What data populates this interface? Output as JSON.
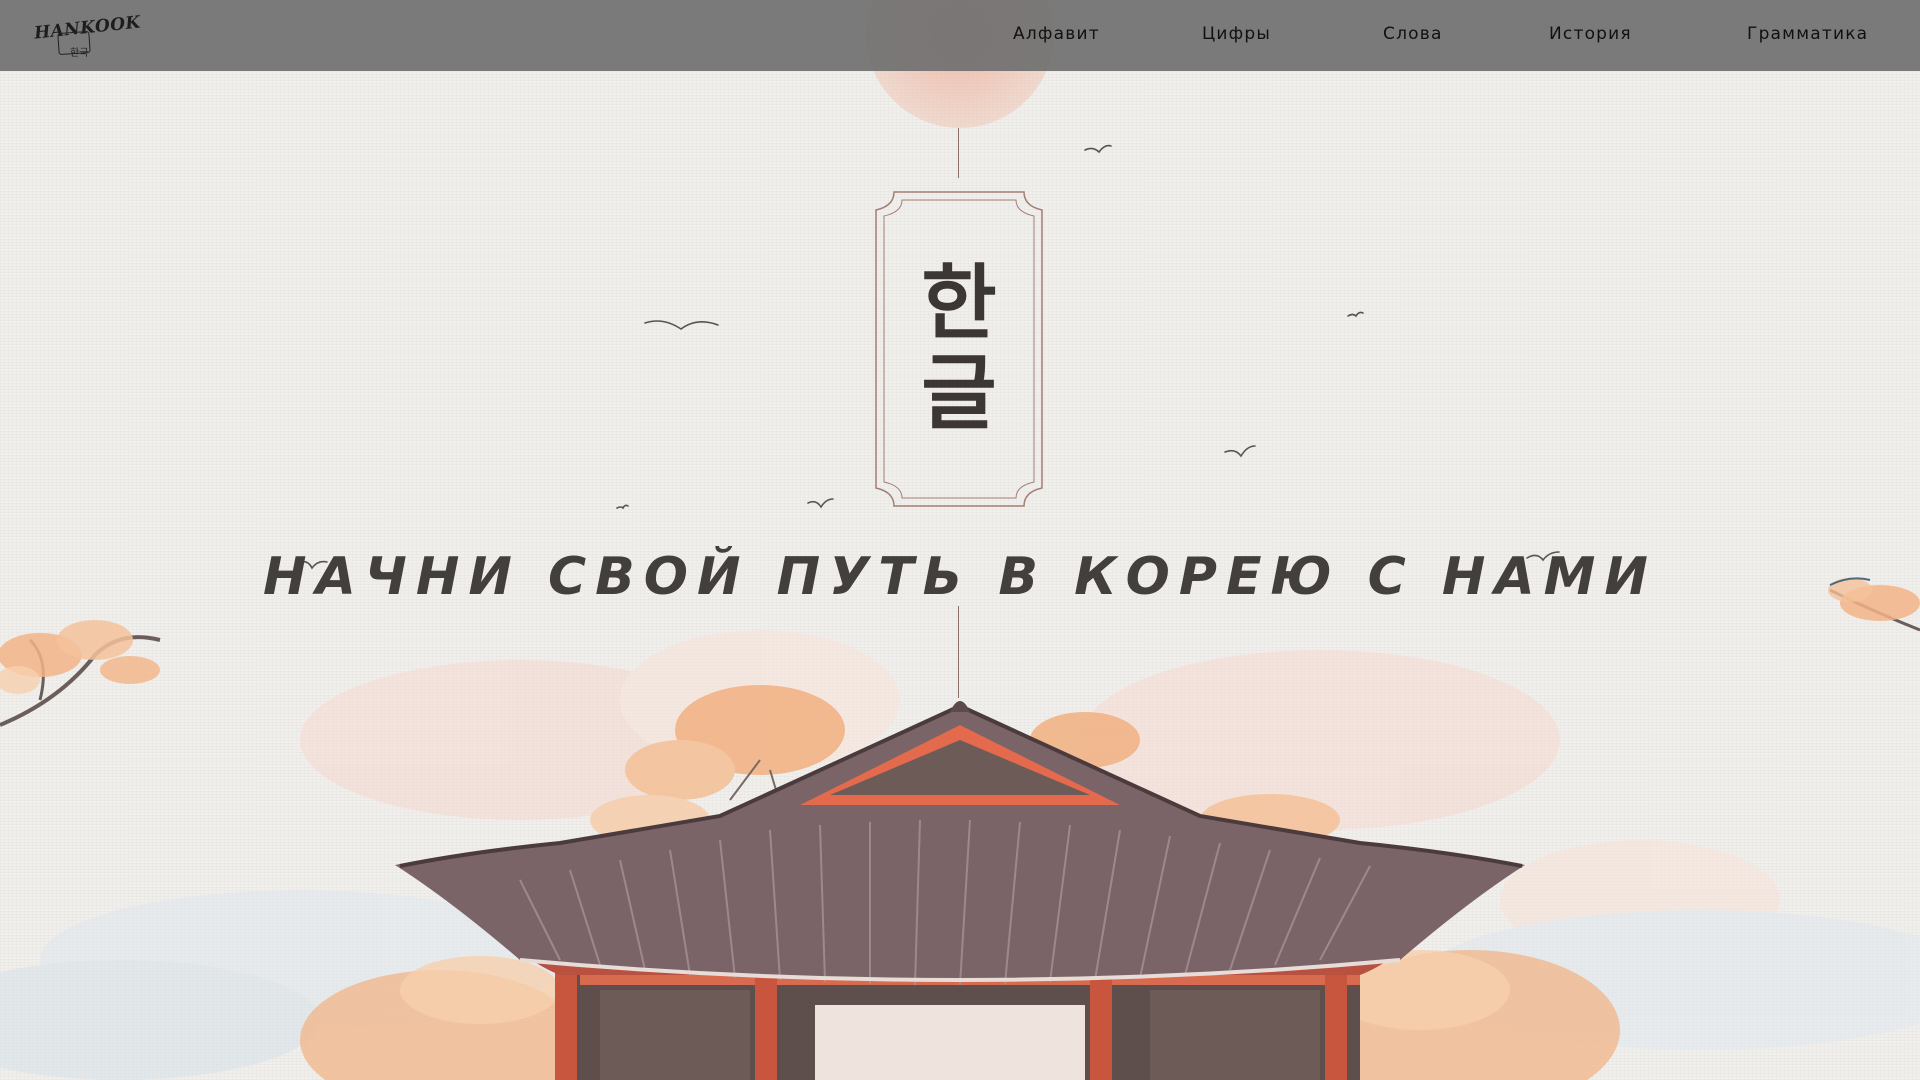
{
  "header": {
    "logo": {
      "name": "HANKOOK",
      "sub": "한국"
    },
    "nav": [
      {
        "label": "Алфавит"
      },
      {
        "label": "Цифры"
      },
      {
        "label": "Слова"
      },
      {
        "label": "История"
      },
      {
        "label": "Грамматика"
      }
    ]
  },
  "hero": {
    "plaque_chars": [
      "한",
      "글"
    ],
    "slogan": "НАЧНИ СВОЙ ПУТЬ В КОРЕЮ С НАМИ"
  },
  "colors": {
    "nav_bg": "#707070",
    "paper": "#f1efec",
    "roof": "#7b6468",
    "pillar": "#c8553d",
    "blossom": "#f2b487",
    "ink": "#3c3735"
  },
  "icons": [
    "logo-icon",
    "birds-icon",
    "palace-roof-illustration",
    "cherry-blossom-branch-icon"
  ]
}
